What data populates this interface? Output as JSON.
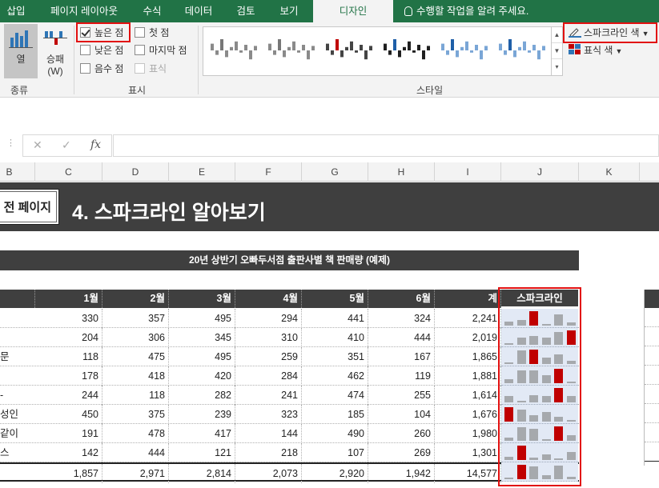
{
  "ribbon": {
    "tabs": [
      {
        "label": "삽입",
        "active": false
      },
      {
        "label": "페이지 레이아웃",
        "active": false
      },
      {
        "label": "수식",
        "active": false
      },
      {
        "label": "데이터",
        "active": false
      },
      {
        "label": "검토",
        "active": false
      },
      {
        "label": "보기",
        "active": false
      },
      {
        "label": "디자인",
        "active": true
      }
    ],
    "tell_me": "수행할 작업을 알려 주세요.",
    "type_group": {
      "label": "종류",
      "line_btn": "열",
      "winloss_btn_line1": "승패",
      "winloss_btn_line2": "(W)"
    },
    "show_group": {
      "label": "표시",
      "checks": [
        {
          "label": "높은 점",
          "checked": true,
          "disabled": false
        },
        {
          "label": "낮은 점",
          "checked": false,
          "disabled": false
        },
        {
          "label": "음수 점",
          "checked": false,
          "disabled": false
        },
        {
          "label": "첫 점",
          "checked": false,
          "disabled": false
        },
        {
          "label": "마지막 점",
          "checked": false,
          "disabled": false
        },
        {
          "label": "표식",
          "checked": false,
          "disabled": true
        }
      ]
    },
    "style_group": {
      "label": "스타일",
      "accent_colors": [
        "#777777",
        "#777777",
        "#c00000",
        "#1f5fa8",
        "#1f5fa8",
        "#1f5fa8"
      ]
    },
    "sparkline_color_btn": "스파크라인 색",
    "marker_color_btn": "표식 색"
  },
  "formula_bar": {
    "cancel_icon": "✕",
    "enter_icon": "✓",
    "fx_label": "fx",
    "value": ""
  },
  "columns": [
    "B",
    "C",
    "D",
    "E",
    "F",
    "G",
    "H",
    "I",
    "J",
    "K"
  ],
  "sheet": {
    "prev_page": "전 페이지",
    "title": "4. 스파크라인 알아보기",
    "subtitle": "20년 상반기 오빠두서점 출판사별 책 판매량 (예제)",
    "headers": [
      "1월",
      "2월",
      "3월",
      "4월",
      "5월",
      "6월",
      "계",
      "스파크라인"
    ],
    "rows": [
      {
        "name": "",
        "values": [
          "330",
          "357",
          "495",
          "294",
          "441",
          "324"
        ],
        "total": "2,241",
        "spark": [
          330,
          357,
          495,
          294,
          441,
          324
        ]
      },
      {
        "name": "",
        "values": [
          "204",
          "306",
          "345",
          "310",
          "410",
          "444"
        ],
        "total": "2,019",
        "spark": [
          204,
          306,
          345,
          310,
          410,
          444
        ]
      },
      {
        "name": "문",
        "values": [
          "118",
          "475",
          "495",
          "259",
          "351",
          "167"
        ],
        "total": "1,865",
        "spark": [
          118,
          475,
          495,
          259,
          351,
          167
        ]
      },
      {
        "name": "",
        "values": [
          "178",
          "418",
          "420",
          "284",
          "462",
          "119"
        ],
        "total": "1,881",
        "spark": [
          178,
          418,
          420,
          284,
          462,
          119
        ]
      },
      {
        "name": "-",
        "values": [
          "244",
          "118",
          "282",
          "241",
          "474",
          "255"
        ],
        "total": "1,614",
        "spark": [
          244,
          118,
          282,
          241,
          474,
          255
        ]
      },
      {
        "name": "성인",
        "values": [
          "450",
          "375",
          "239",
          "323",
          "185",
          "104"
        ],
        "total": "1,676",
        "spark": [
          450,
          375,
          239,
          323,
          185,
          104
        ]
      },
      {
        "name": "같이",
        "values": [
          "191",
          "478",
          "417",
          "144",
          "490",
          "260"
        ],
        "total": "1,980",
        "spark": [
          191,
          478,
          417,
          144,
          490,
          260
        ]
      },
      {
        "name": "스",
        "values": [
          "142",
          "444",
          "121",
          "218",
          "107",
          "269"
        ],
        "total": "1,301",
        "spark": [
          142,
          444,
          121,
          218,
          107,
          269
        ]
      }
    ],
    "total_row": {
      "values": [
        "1,857",
        "2,971",
        "2,814",
        "2,073",
        "2,920",
        "1,942"
      ],
      "total": "14,577",
      "spark": [
        1857,
        2971,
        2814,
        2073,
        2920,
        1942
      ]
    },
    "spark_colors": {
      "normal": "#a6a9ad",
      "high": "#c00000"
    }
  }
}
